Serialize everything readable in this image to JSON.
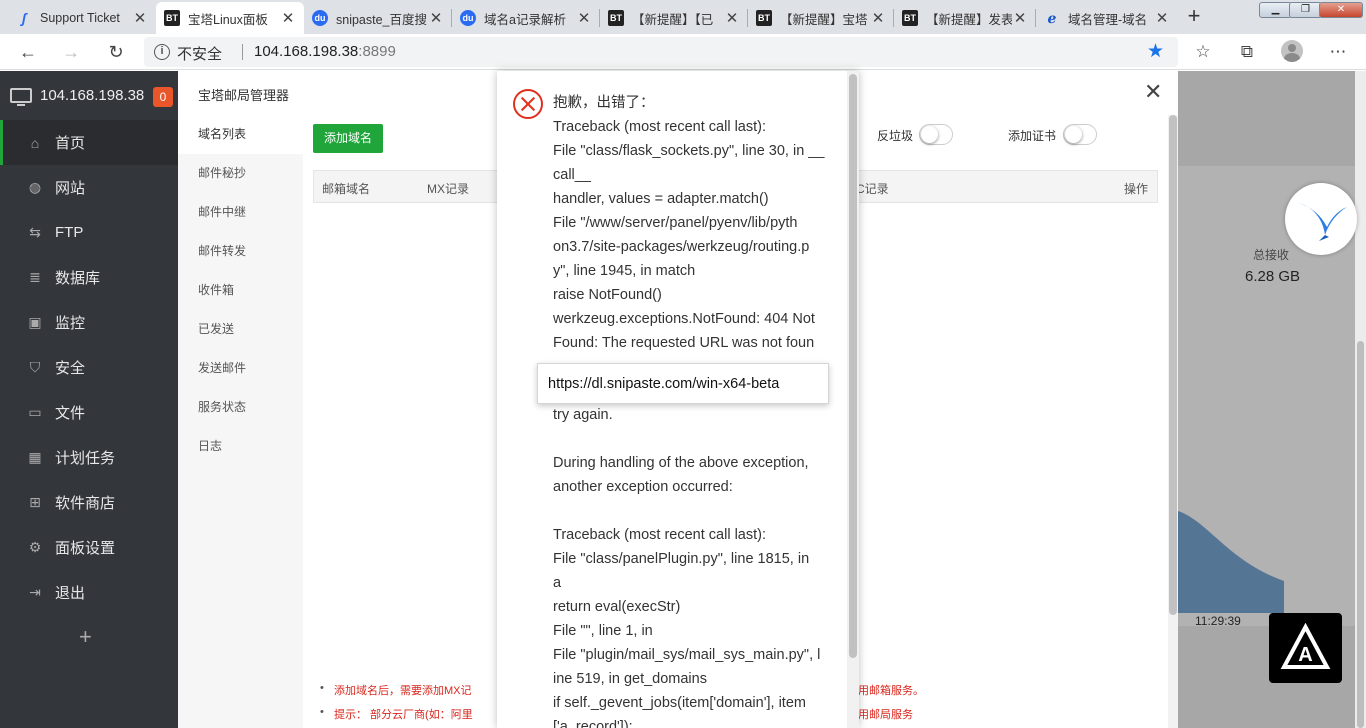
{
  "browser": {
    "tabs": [
      {
        "label": "Support Ticket",
        "favicon": "snipaste-s-icon",
        "active": false
      },
      {
        "label": "宝塔Linux面板",
        "favicon": "bt-icon",
        "active": true
      },
      {
        "label": "snipaste_百度搜",
        "favicon": "baidu-paw-icon",
        "active": false
      },
      {
        "label": "域名a记录解析",
        "favicon": "baidu-paw-icon",
        "active": false
      },
      {
        "label": "【新提醒】【已",
        "favicon": "bt-icon",
        "active": false
      },
      {
        "label": "【新提醒】宝塔",
        "favicon": "bt-icon",
        "active": false
      },
      {
        "label": "【新提醒】发表",
        "favicon": "bt-icon",
        "active": false
      },
      {
        "label": "域名管理-域名",
        "favicon": "ie-icon",
        "active": false
      }
    ],
    "new_tab": "+",
    "address": {
      "security": "不安全",
      "host": "104.168.198.38",
      "port": ":8899"
    }
  },
  "sidebar": {
    "server": "104.168.198.38",
    "badge": "0",
    "items": [
      {
        "label": "首页",
        "icon": "home-icon",
        "active": true
      },
      {
        "label": "网站",
        "icon": "globe-icon"
      },
      {
        "label": "FTP",
        "icon": "ftp-icon"
      },
      {
        "label": "数据库",
        "icon": "database-icon"
      },
      {
        "label": "监控",
        "icon": "monitor-icon"
      },
      {
        "label": "安全",
        "icon": "shield-icon"
      },
      {
        "label": "文件",
        "icon": "folder-icon"
      },
      {
        "label": "计划任务",
        "icon": "calendar-icon"
      },
      {
        "label": "软件商店",
        "icon": "grid-icon"
      },
      {
        "label": "面板设置",
        "icon": "settings-icon"
      },
      {
        "label": "退出",
        "icon": "logout-icon"
      }
    ],
    "add": "+"
  },
  "dashboard": {
    "total_recv_label": "总接收",
    "total_recv_value": "6.28 GB",
    "time_tick": "11:29:39"
  },
  "mail": {
    "title": "宝塔邮局管理器",
    "nav": [
      "域名列表",
      "邮件秘抄",
      "邮件中继",
      "邮件转发",
      "收件箱",
      "已发送",
      "发送邮件",
      "服务状态",
      "日志"
    ],
    "add_domain": "添加域名",
    "toggle_spam": "反垃圾",
    "toggle_cert": "添加证书",
    "table": {
      "col_domain": "邮箱域名",
      "col_mx": "MX记录",
      "col_c": "C记录",
      "col_op": "操作"
    },
    "note1": "添加域名后，需要添加MX记",
    "note1_right": "用邮箱服务。",
    "note2": "提示： 部分云厂商(如：阿里",
    "note2_right": "用邮局服务"
  },
  "error": {
    "lines": [
      "抱歉，出错了：",
      "Traceback (most recent call last):",
      "File \"class/flask_sockets.py\", line 30, in __",
      "call__",
      "handler, values = adapter.match()",
      "File \"/www/server/panel/pyenv/lib/pyth",
      "on3.7/site-packages/werkzeug/routing.p",
      "y\", line 1945, in match",
      "raise NotFound()",
      "werkzeug.exceptions.NotFound: 404 Not",
      "Found: The requested URL was not foun",
      "",
      "",
      "try again.",
      "",
      "During handling of the above exception,",
      "another exception occurred:",
      "",
      "Traceback (most recent call last):",
      "File \"class/panelPlugin.py\", line 1815, in",
      "a",
      "return eval(execStr)",
      "File \"\", line 1, in",
      "File \"plugin/mail_sys/mail_sys_main.py\", l",
      "ine 519, in get_domains",
      "if self._gevent_jobs(item['domain'], item",
      "['a_record']):"
    ]
  },
  "tooltip": "https://dl.snipaste.com/win-x64-beta"
}
